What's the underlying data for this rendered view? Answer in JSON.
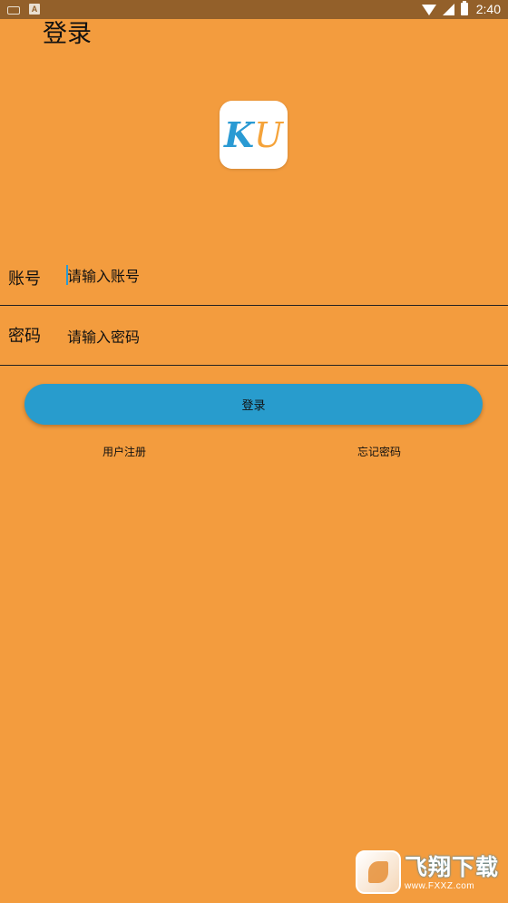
{
  "status_bar": {
    "time": "2:40",
    "icons": [
      "keyboard-icon",
      "a-icon",
      "wifi-icon",
      "signal-icon",
      "battery-icon"
    ]
  },
  "page": {
    "title": "登录"
  },
  "logo": {
    "letter_k": "K",
    "letter_u": "U"
  },
  "form": {
    "account_label": "账号",
    "account_placeholder": "请输入账号",
    "account_value": "",
    "password_label": "密码",
    "password_placeholder": "请输入密码",
    "password_value": ""
  },
  "actions": {
    "login_label": "登录",
    "register_label": "用户注册",
    "forgot_label": "忘记密码"
  },
  "watermark": {
    "name": "飞翔下载",
    "url": "www.FXXZ.com"
  },
  "colors": {
    "background": "#F39C3E",
    "status_bar": "#93602A",
    "button": "#289CCD",
    "logo_k": "#2A9AD3",
    "logo_u": "#F5A33A"
  }
}
